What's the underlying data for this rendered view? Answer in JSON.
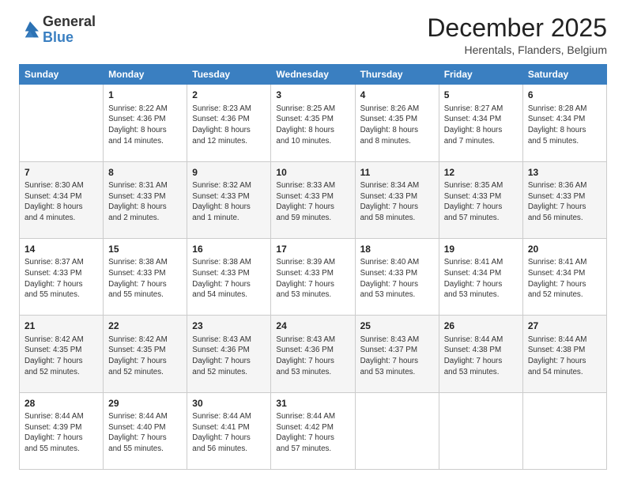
{
  "logo": {
    "general": "General",
    "blue": "Blue"
  },
  "header": {
    "month": "December 2025",
    "location": "Herentals, Flanders, Belgium"
  },
  "days_of_week": [
    "Sunday",
    "Monday",
    "Tuesday",
    "Wednesday",
    "Thursday",
    "Friday",
    "Saturday"
  ],
  "weeks": [
    [
      {
        "day": "",
        "info": ""
      },
      {
        "day": "1",
        "info": "Sunrise: 8:22 AM\nSunset: 4:36 PM\nDaylight: 8 hours\nand 14 minutes."
      },
      {
        "day": "2",
        "info": "Sunrise: 8:23 AM\nSunset: 4:36 PM\nDaylight: 8 hours\nand 12 minutes."
      },
      {
        "day": "3",
        "info": "Sunrise: 8:25 AM\nSunset: 4:35 PM\nDaylight: 8 hours\nand 10 minutes."
      },
      {
        "day": "4",
        "info": "Sunrise: 8:26 AM\nSunset: 4:35 PM\nDaylight: 8 hours\nand 8 minutes."
      },
      {
        "day": "5",
        "info": "Sunrise: 8:27 AM\nSunset: 4:34 PM\nDaylight: 8 hours\nand 7 minutes."
      },
      {
        "day": "6",
        "info": "Sunrise: 8:28 AM\nSunset: 4:34 PM\nDaylight: 8 hours\nand 5 minutes."
      }
    ],
    [
      {
        "day": "7",
        "info": "Sunrise: 8:30 AM\nSunset: 4:34 PM\nDaylight: 8 hours\nand 4 minutes."
      },
      {
        "day": "8",
        "info": "Sunrise: 8:31 AM\nSunset: 4:33 PM\nDaylight: 8 hours\nand 2 minutes."
      },
      {
        "day": "9",
        "info": "Sunrise: 8:32 AM\nSunset: 4:33 PM\nDaylight: 8 hours\nand 1 minute."
      },
      {
        "day": "10",
        "info": "Sunrise: 8:33 AM\nSunset: 4:33 PM\nDaylight: 7 hours\nand 59 minutes."
      },
      {
        "day": "11",
        "info": "Sunrise: 8:34 AM\nSunset: 4:33 PM\nDaylight: 7 hours\nand 58 minutes."
      },
      {
        "day": "12",
        "info": "Sunrise: 8:35 AM\nSunset: 4:33 PM\nDaylight: 7 hours\nand 57 minutes."
      },
      {
        "day": "13",
        "info": "Sunrise: 8:36 AM\nSunset: 4:33 PM\nDaylight: 7 hours\nand 56 minutes."
      }
    ],
    [
      {
        "day": "14",
        "info": "Sunrise: 8:37 AM\nSunset: 4:33 PM\nDaylight: 7 hours\nand 55 minutes."
      },
      {
        "day": "15",
        "info": "Sunrise: 8:38 AM\nSunset: 4:33 PM\nDaylight: 7 hours\nand 55 minutes."
      },
      {
        "day": "16",
        "info": "Sunrise: 8:38 AM\nSunset: 4:33 PM\nDaylight: 7 hours\nand 54 minutes."
      },
      {
        "day": "17",
        "info": "Sunrise: 8:39 AM\nSunset: 4:33 PM\nDaylight: 7 hours\nand 53 minutes."
      },
      {
        "day": "18",
        "info": "Sunrise: 8:40 AM\nSunset: 4:33 PM\nDaylight: 7 hours\nand 53 minutes."
      },
      {
        "day": "19",
        "info": "Sunrise: 8:41 AM\nSunset: 4:34 PM\nDaylight: 7 hours\nand 53 minutes."
      },
      {
        "day": "20",
        "info": "Sunrise: 8:41 AM\nSunset: 4:34 PM\nDaylight: 7 hours\nand 52 minutes."
      }
    ],
    [
      {
        "day": "21",
        "info": "Sunrise: 8:42 AM\nSunset: 4:35 PM\nDaylight: 7 hours\nand 52 minutes."
      },
      {
        "day": "22",
        "info": "Sunrise: 8:42 AM\nSunset: 4:35 PM\nDaylight: 7 hours\nand 52 minutes."
      },
      {
        "day": "23",
        "info": "Sunrise: 8:43 AM\nSunset: 4:36 PM\nDaylight: 7 hours\nand 52 minutes."
      },
      {
        "day": "24",
        "info": "Sunrise: 8:43 AM\nSunset: 4:36 PM\nDaylight: 7 hours\nand 53 minutes."
      },
      {
        "day": "25",
        "info": "Sunrise: 8:43 AM\nSunset: 4:37 PM\nDaylight: 7 hours\nand 53 minutes."
      },
      {
        "day": "26",
        "info": "Sunrise: 8:44 AM\nSunset: 4:38 PM\nDaylight: 7 hours\nand 53 minutes."
      },
      {
        "day": "27",
        "info": "Sunrise: 8:44 AM\nSunset: 4:38 PM\nDaylight: 7 hours\nand 54 minutes."
      }
    ],
    [
      {
        "day": "28",
        "info": "Sunrise: 8:44 AM\nSunset: 4:39 PM\nDaylight: 7 hours\nand 55 minutes."
      },
      {
        "day": "29",
        "info": "Sunrise: 8:44 AM\nSunset: 4:40 PM\nDaylight: 7 hours\nand 55 minutes."
      },
      {
        "day": "30",
        "info": "Sunrise: 8:44 AM\nSunset: 4:41 PM\nDaylight: 7 hours\nand 56 minutes."
      },
      {
        "day": "31",
        "info": "Sunrise: 8:44 AM\nSunset: 4:42 PM\nDaylight: 7 hours\nand 57 minutes."
      },
      {
        "day": "",
        "info": ""
      },
      {
        "day": "",
        "info": ""
      },
      {
        "day": "",
        "info": ""
      }
    ]
  ]
}
